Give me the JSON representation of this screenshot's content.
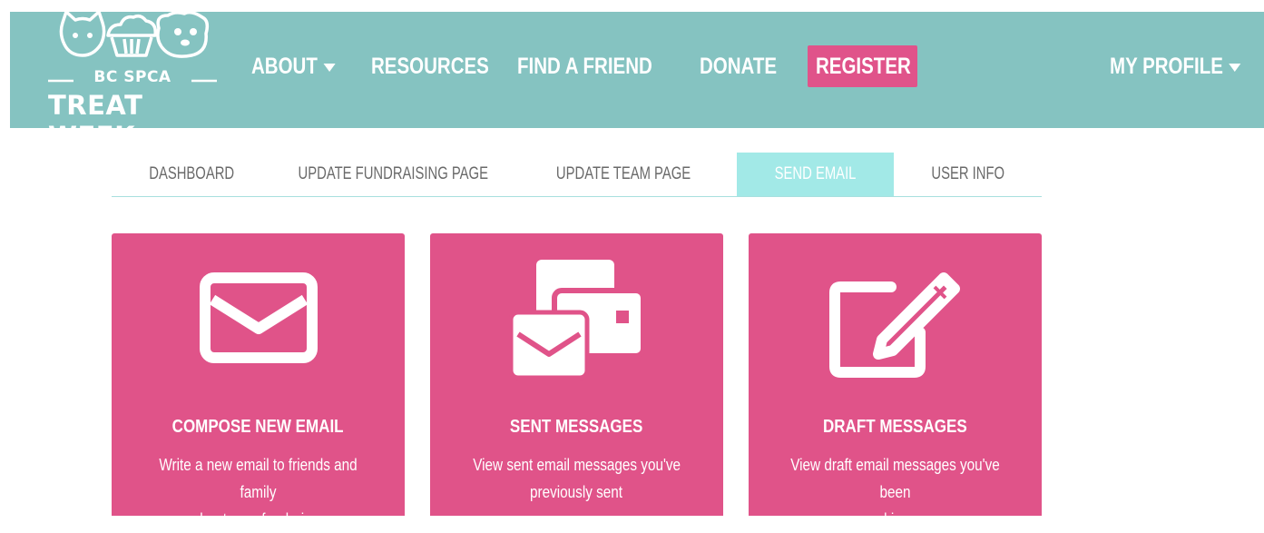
{
  "brand": {
    "subtitle": "BC SPCA",
    "name": "TREAT WEEK"
  },
  "nav": {
    "about": "ABOUT",
    "resources": "RESOURCES",
    "find_a_friend": "FIND A FRIEND",
    "donate": "DONATE",
    "register": "REGISTER",
    "my_profile": "MY PROFILE"
  },
  "tabs": [
    {
      "label": "DASHBOARD",
      "active": false
    },
    {
      "label": "UPDATE FUNDRAISING PAGE",
      "active": false
    },
    {
      "label": "UPDATE TEAM PAGE",
      "active": false
    },
    {
      "label": "SEND EMAIL",
      "active": true
    },
    {
      "label": "USER INFO",
      "active": false
    }
  ],
  "cards": [
    {
      "icon": "envelope-icon",
      "title": "COMPOSE NEW EMAIL",
      "desc_line1": "Write a new email to friends and family",
      "desc_line2": "about your fundraiser"
    },
    {
      "icon": "sent-messages-icon",
      "title": "SENT MESSAGES",
      "desc_line1": "View sent email messages you've",
      "desc_line2": "previously sent"
    },
    {
      "icon": "edit-icon",
      "title": "DRAFT MESSAGES",
      "desc_line1": "View draft email messages you've been",
      "desc_line2": "working on"
    }
  ],
  "colors": {
    "navbar": "#85c3c1",
    "accent_pink": "#e05389",
    "active_tab": "#a2e9e7"
  }
}
